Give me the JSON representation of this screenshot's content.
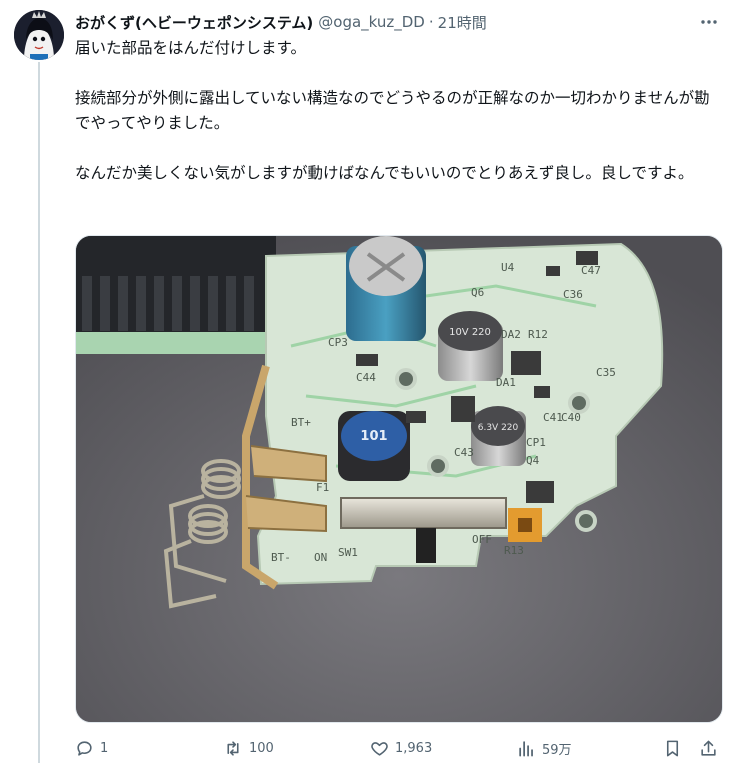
{
  "tweet": {
    "display_name": "おがくず(ヘビーウェポンシステム)",
    "handle": "@oga_kuz_DD",
    "separator": "·",
    "time": "21時間",
    "paragraphs": [
      "届いた部品をはんだ付けします。",
      "接続部分が外側に露出していない構造なのでどうやるのが正解なのか一切わかりませんが勘でやってやりました。",
      "なんだか美しくない気がしますが動けばなんでもいいのでとりあえず良し。良しですよ。"
    ]
  },
  "photo": {
    "board_labels": [
      "CP3",
      "C44",
      "Q6",
      "CP1",
      "Q4",
      "C43",
      "C41",
      "C40",
      "C35",
      "R12",
      "DA2",
      "DA1",
      "BT+",
      "BT-",
      "ON",
      "SW1",
      "OFF",
      "R13",
      "F1",
      "U4",
      "C36",
      "C47"
    ],
    "inductor_marking": "101",
    "capacitor_markings": [
      "10V 220",
      "6.3V 220"
    ]
  },
  "actions": {
    "reply": {
      "icon": "reply-icon",
      "count": "1"
    },
    "repost": {
      "icon": "repost-icon",
      "count": "100"
    },
    "like": {
      "icon": "heart-icon",
      "count": "1,963"
    },
    "views": {
      "icon": "views-chart-icon",
      "count": "59万"
    },
    "bookmark": {
      "icon": "bookmark-icon"
    },
    "share": {
      "icon": "share-icon"
    }
  },
  "colors": {
    "text": "#0f1419",
    "secondary": "#536471",
    "pcb": "#d8e6d6",
    "pcb_trace": "#9fd3a6",
    "mat": "#6d6c71",
    "connector": "#24262a"
  }
}
